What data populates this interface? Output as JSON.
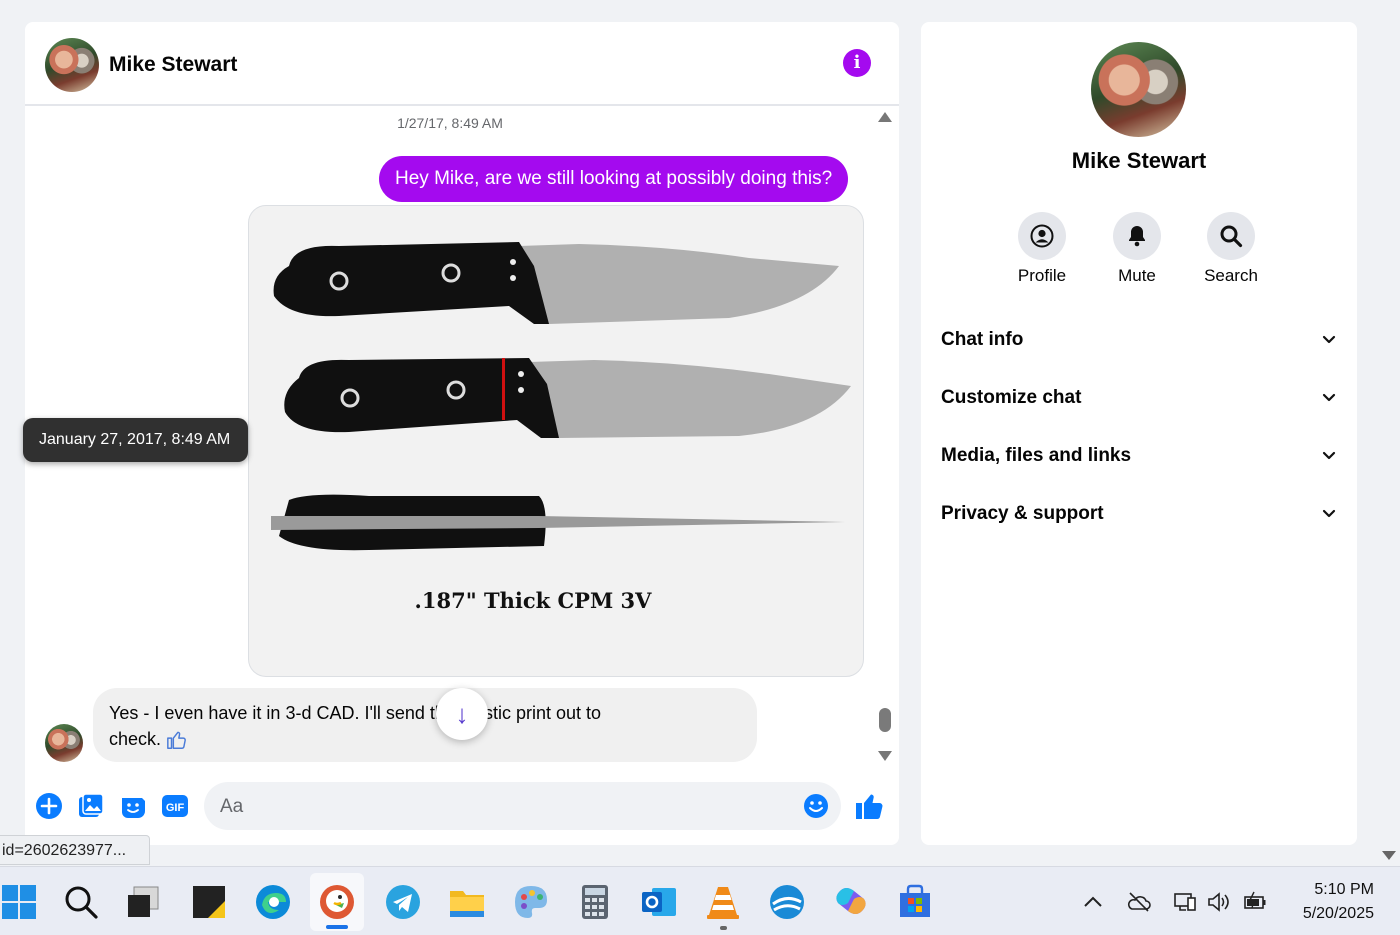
{
  "chat": {
    "contact_name": "Mike Stewart",
    "timestamp": "1/27/17, 8:49 AM",
    "outgoing_message": "Hey Mike, are we still looking at possibly doing this?",
    "image_caption": ".187\" Thick CPM 3V",
    "tooltip": "January 27, 2017, 8:49 AM",
    "incoming_message_line1": "Yes - I even have it in 3-d CAD.  I'll send the plastic print out to",
    "incoming_message_line2": "check.",
    "composer_placeholder": "Aa",
    "composer_icons": [
      "plus-icon",
      "photo-icon",
      "sticker-icon",
      "gif-icon"
    ],
    "gif_label": "GIF"
  },
  "right_panel": {
    "name": "Mike Stewart",
    "actions": [
      {
        "label": "Profile",
        "icon": "profile-icon"
      },
      {
        "label": "Mute",
        "icon": "bell-icon"
      },
      {
        "label": "Search",
        "icon": "search-icon"
      }
    ],
    "sections": [
      "Chat info",
      "Customize chat",
      "Media, files and links",
      "Privacy & support"
    ]
  },
  "status_bar": {
    "url": "id=2602623977..."
  },
  "taskbar": {
    "apps": [
      "windows-start",
      "search",
      "task-view",
      "sticky-notes",
      "edge",
      "duckduckgo",
      "telegram",
      "file-explorer",
      "paint",
      "calculator",
      "outlook",
      "vlc",
      "virtualbox",
      "copilot",
      "microsoft-store"
    ],
    "time": "5:10 PM",
    "date": "5/20/2025"
  },
  "colors": {
    "accent": "#a40aef",
    "messenger_blue": "#0a7cff",
    "panel_bg": "#ffffff",
    "page_bg": "#f0f2f5"
  }
}
